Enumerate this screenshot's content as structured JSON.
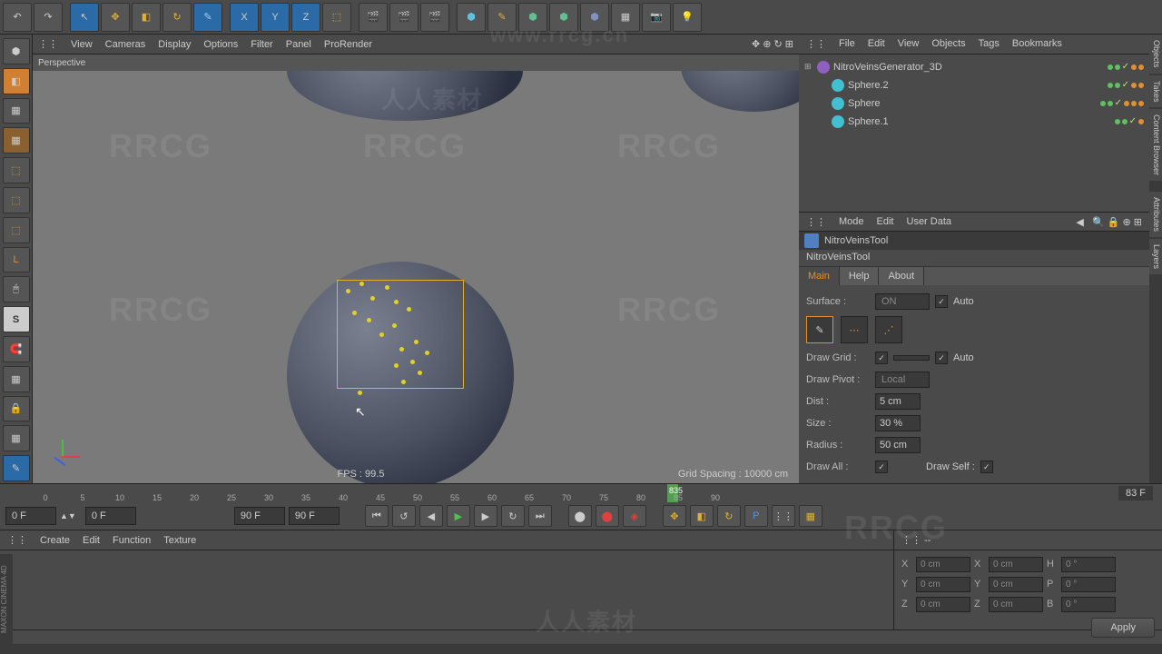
{
  "viewport": {
    "menu": [
      "View",
      "Cameras",
      "Display",
      "Options",
      "Filter",
      "Panel",
      "ProRender"
    ],
    "label": "Perspective",
    "fps": "FPS : 99.5",
    "grid": "Grid Spacing : 10000 cm"
  },
  "objects": {
    "menu": [
      "File",
      "Edit",
      "View",
      "Objects",
      "Tags",
      "Bookmarks"
    ],
    "items": [
      {
        "name": "NitroVeinsGenerator_3D",
        "icon": "violet",
        "indent": 0,
        "exp": "⊞"
      },
      {
        "name": "Sphere.2",
        "icon": "cyan",
        "indent": 1,
        "exp": ""
      },
      {
        "name": "Sphere",
        "icon": "cyan",
        "indent": 1,
        "exp": ""
      },
      {
        "name": "Sphere.1",
        "icon": "cyan",
        "indent": 1,
        "exp": ""
      }
    ]
  },
  "attributes": {
    "menu": [
      "Mode",
      "Edit",
      "User Data"
    ],
    "title": "NitroVeinsTool",
    "subtitle": "NitroVeinsTool",
    "tabs": [
      "Main",
      "Help",
      "About"
    ],
    "surface": {
      "label": "Surface :",
      "value": "ON",
      "auto": "Auto"
    },
    "drawGrid": {
      "label": "Draw Grid :",
      "auto": "Auto"
    },
    "drawPivot": {
      "label": "Draw Pivot :",
      "value": "Local"
    },
    "dist": {
      "label": "Dist :",
      "value": "5 cm"
    },
    "size": {
      "label": "Size :",
      "value": "30 %"
    },
    "radius": {
      "label": "Radius :",
      "value": "50 cm"
    },
    "drawAll": {
      "label": "Draw All :"
    },
    "drawSelf": {
      "label": "Draw Self :"
    }
  },
  "timeline": {
    "ticks": [
      "0",
      "5",
      "10",
      "15",
      "20",
      "25",
      "30",
      "35",
      "40",
      "45",
      "50",
      "55",
      "60",
      "65",
      "70",
      "75",
      "80",
      "85",
      "90"
    ],
    "current": "835",
    "frameDisplay": "83 F",
    "start": "0 F",
    "startInner": "0 F",
    "endInner": "90 F",
    "end": "90 F"
  },
  "materials": {
    "menu": [
      "Create",
      "Edit",
      "Function",
      "Texture"
    ]
  },
  "coords": {
    "rows": [
      {
        "l1": "X",
        "v1": "0 cm",
        "l2": "X",
        "v2": "0 cm",
        "l3": "H",
        "v3": "0 °"
      },
      {
        "l1": "Y",
        "v1": "0 cm",
        "l2": "Y",
        "v2": "0 cm",
        "l3": "P",
        "v3": "0 °"
      },
      {
        "l1": "Z",
        "v1": "0 cm",
        "l2": "Z",
        "v2": "0 cm",
        "l3": "B",
        "v3": "0 °"
      }
    ],
    "apply": "Apply"
  },
  "rightTabs": [
    "Objects",
    "Takes",
    "Content Browser",
    "Attributes",
    "Layers"
  ],
  "brand": "MAXON CINEMA 4D",
  "watermark_url": "www.rrcg.cn",
  "watermark_text": "RRCG",
  "watermark_cn": "人人素材"
}
